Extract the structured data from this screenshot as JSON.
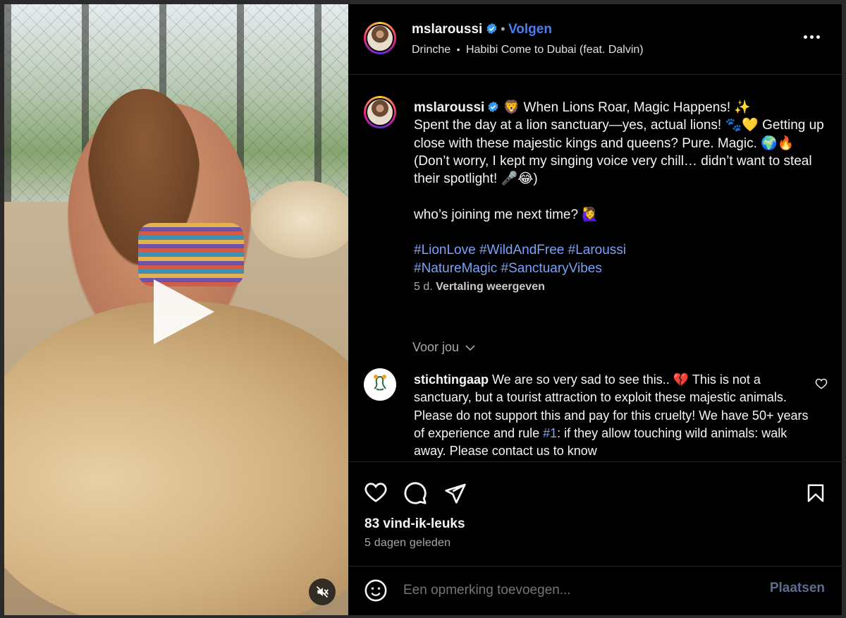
{
  "post": {
    "username": "mslaroussi",
    "follow_label": "Volgen",
    "separator": "•",
    "audio": {
      "artist": "Drinche",
      "track": "Habibi Come to Dubai (feat. Dalvin)"
    },
    "media": {
      "type": "video",
      "play_icon": "play-icon",
      "mute_icon": "speaker-muted-icon"
    }
  },
  "caption": {
    "username": "mslaroussi",
    "text_line1": " 🦁 When Lions Roar, Magic Happens! ✨",
    "text_body": "Spent the day at a lion sanctuary—yes, actual lions! 🐾💛 Getting up close with these majestic kings and queens? Pure. Magic. 🌍🔥\n(Don’t worry, I kept my singing voice very chill… didn’t want to steal their spotlight! 🎤😂)\n\nwho’s joining me next time? 🙋‍♀️",
    "hashtags_line1": "#LionLove #WildAndFree #Laroussi",
    "hashtags_line2": "#NatureMagic #SanctuaryVibes",
    "age": "5 d.",
    "translate_label": "Vertaling weergeven"
  },
  "for_you_label": "Voor jou",
  "comment": {
    "username": "stichtingaap",
    "text_before": " We are so very sad to see this.. 💔 This is not a sanctuary, but a tourist attraction to exploit these majestic animals. Please do not support this and pay for this cruelty! We have 50+ years of experience and rule ",
    "hashtag": "#1",
    "text_after": ": if they allow touching wild animals: walk away. Please contact us to know"
  },
  "actions": {
    "like_icon": "heart-icon",
    "comment_icon": "comment-icon",
    "share_icon": "send-icon",
    "save_icon": "bookmark-icon"
  },
  "likes_text": "83 vind-ik-leuks",
  "posted_ago": "5 dagen geleden",
  "composer": {
    "placeholder": "Een opmerking toevoegen...",
    "post_label": "Plaatsen",
    "emoji_icon": "emoji-icon"
  },
  "colors": {
    "accent": "#4a7cf3",
    "hashtag": "#7aa2f7",
    "post_disabled": "#5e6c8f",
    "background": "#000000"
  }
}
